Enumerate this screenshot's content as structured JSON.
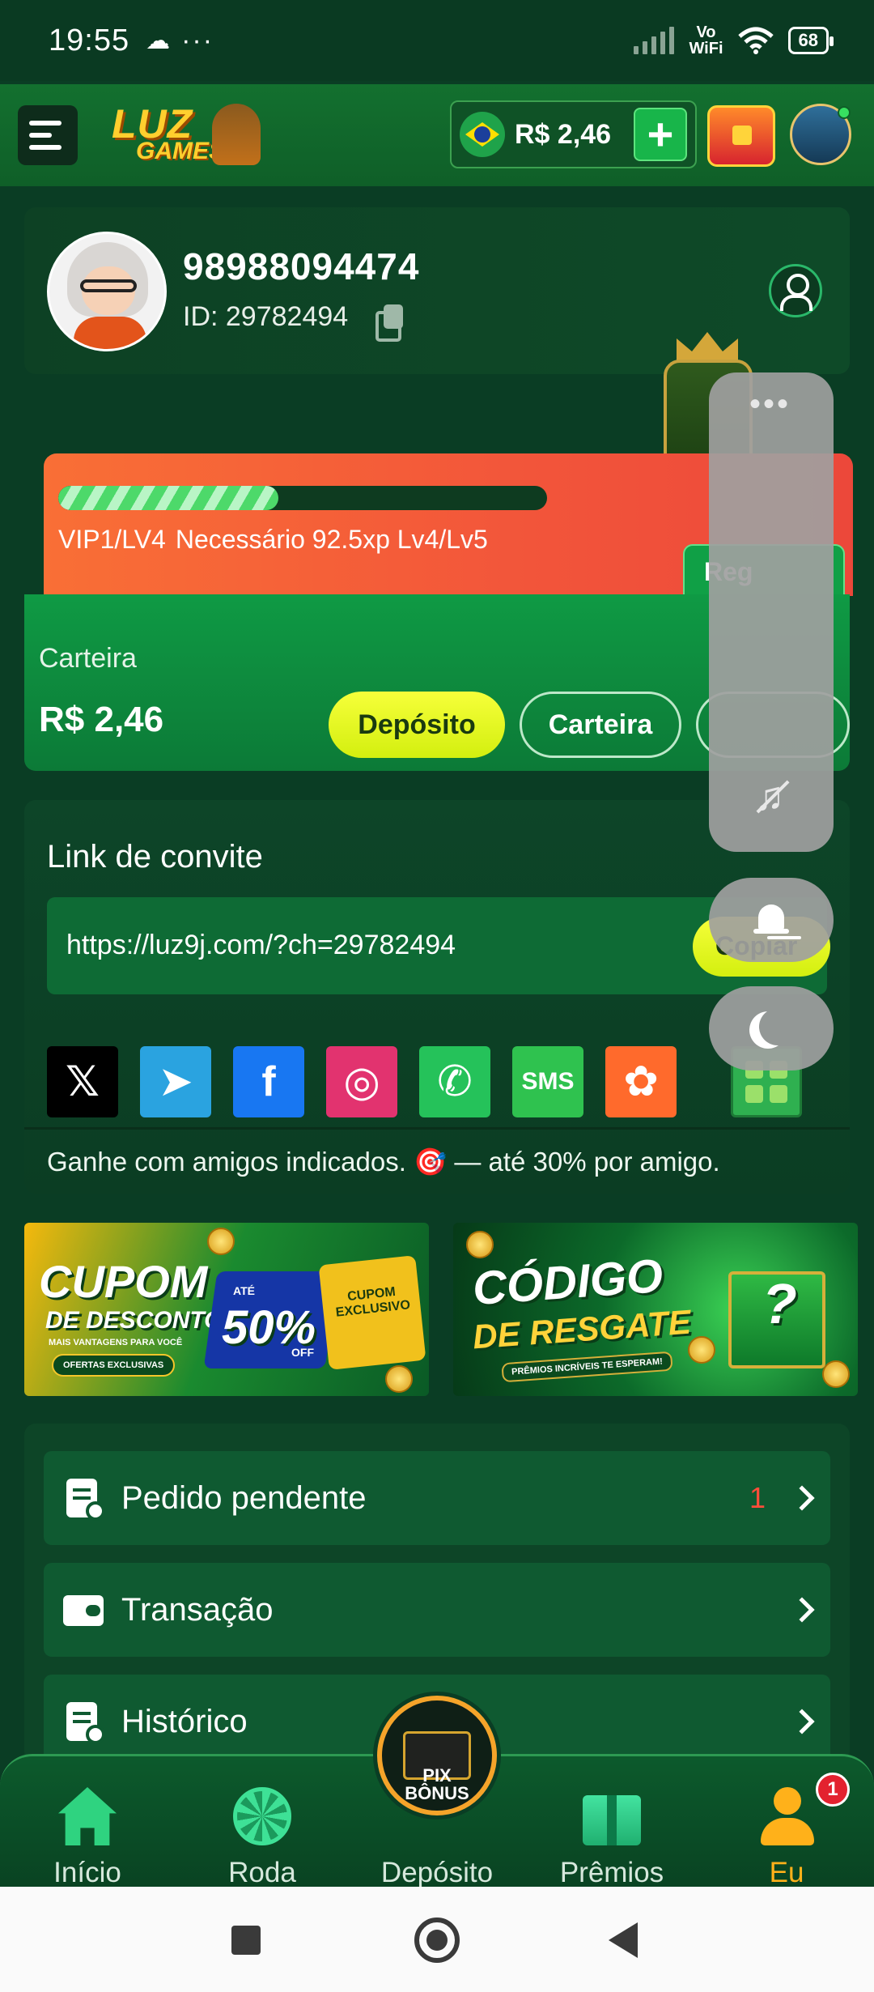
{
  "status_bar": {
    "time": "19:55",
    "overflow": "···",
    "network_label_top": "Vo",
    "network_label_bottom": "WiFi",
    "battery": "68",
    "icons": [
      "cloud-icon",
      "signal-icon",
      "wifi-icon",
      "battery-icon"
    ]
  },
  "header": {
    "logo_line1": "LUZ",
    "logo_line2": "GAMES",
    "balance": "R$ 2,46",
    "plus_symbol": "+",
    "icons": [
      "menu-icon",
      "brazil-flag-icon",
      "treasure-chest-icon",
      "user-avatar-icon"
    ]
  },
  "profile": {
    "phone": "98988094474",
    "id_label": "ID: 29782494"
  },
  "vip": {
    "level_text": "VIP1/LV4",
    "progress_text": "Necessário 92.5xp Lv4/Lv5",
    "progress_fraction": 0.45,
    "button_label": "Reg"
  },
  "wallet": {
    "label": "Carteira",
    "amount": "R$ 2,46",
    "deposit_label": "Depósito",
    "wallet_label": "Carteira"
  },
  "invite": {
    "title": "Link de convite",
    "url": "https://luz9j.com/?ch=29782494",
    "copy_label": "Copiar",
    "note": "Ganhe com amigos indicados. 🎯 — até 30% por amigo.",
    "socials": [
      {
        "name": "x-icon",
        "glyph": "𝕏",
        "color": "#000000"
      },
      {
        "name": "telegram-icon",
        "glyph": "➤",
        "color": "#2aa3e0"
      },
      {
        "name": "facebook-icon",
        "glyph": "f",
        "color": "#1877f2"
      },
      {
        "name": "instagram-icon",
        "glyph": "◎",
        "color": "#e2336f"
      },
      {
        "name": "whatsapp-icon",
        "glyph": "✆",
        "color": "#25c25a"
      },
      {
        "name": "sms-icon",
        "glyph": "SMS",
        "color": "#2fc24f"
      },
      {
        "name": "kwai-icon",
        "glyph": "✿",
        "color": "#ff6a2c"
      }
    ]
  },
  "banners": {
    "cupom": {
      "title1": "CUPOM",
      "title2": "DE DESCONTO",
      "tagline": "MAIS VANTAGENS PARA VOCÊ",
      "pill": "OFERTAS EXCLUSIVAS",
      "ate": "ATÉ",
      "percent": "50%",
      "off": "OFF",
      "ticket": "CUPOM EXCLUSIVO"
    },
    "codigo": {
      "title1": "CÓDIGO",
      "title2": "DE RESGATE",
      "tagline": "PRÊMIOS INCRÍVEIS TE ESPERAM!"
    }
  },
  "menu_list": [
    {
      "label": "Pedido pendente",
      "count": "1",
      "icon": "pending-order-icon"
    },
    {
      "label": "Transação",
      "count": "",
      "icon": "wallet-icon"
    },
    {
      "label": "Histórico",
      "count": "",
      "icon": "history-icon"
    }
  ],
  "bottom_nav": {
    "items": [
      {
        "label": "Início",
        "icon": "home-icon"
      },
      {
        "label": "Roda",
        "icon": "wheel-icon"
      },
      {
        "label": "Depósito",
        "icon": "pix-bonus-icon"
      },
      {
        "label": "Prêmios",
        "icon": "gift-icon"
      },
      {
        "label": "Eu",
        "icon": "user-icon"
      }
    ],
    "center_line1": "PIX",
    "center_line2": "BÔNUS",
    "badge": "1",
    "active_color": "#ffb11a"
  },
  "floating": {
    "dots": "•••"
  }
}
